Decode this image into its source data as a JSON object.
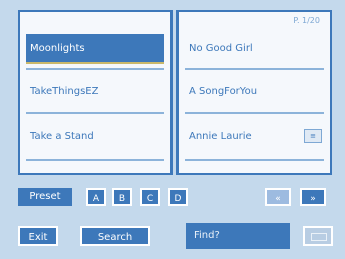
{
  "page_indicator": "P. 1/20",
  "left_list": [
    {
      "label": "Moonlights",
      "selected": true
    },
    {
      "label": "TakeThingsEZ",
      "selected": false
    },
    {
      "label": "Take a Stand",
      "selected": false
    }
  ],
  "right_list": [
    {
      "label": "No Good Girl",
      "selected": false
    },
    {
      "label": "A SongForYou",
      "selected": false
    },
    {
      "label": "Annie Laurie",
      "selected": false
    }
  ],
  "bank_bar": {
    "preset_label": "Preset",
    "letters": [
      "A",
      "B",
      "C",
      "D"
    ],
    "prev_label": "«",
    "next_label": "»"
  },
  "bottom_bar": {
    "exit_label": "Exit",
    "search_label": "Search",
    "search_value": "Find?"
  },
  "colors": {
    "accent": "#3d78ba",
    "background": "#c4d9ec",
    "panel": "#f5f8fc"
  },
  "icons": [
    "song-file-icon",
    "keyboard-icon"
  ]
}
